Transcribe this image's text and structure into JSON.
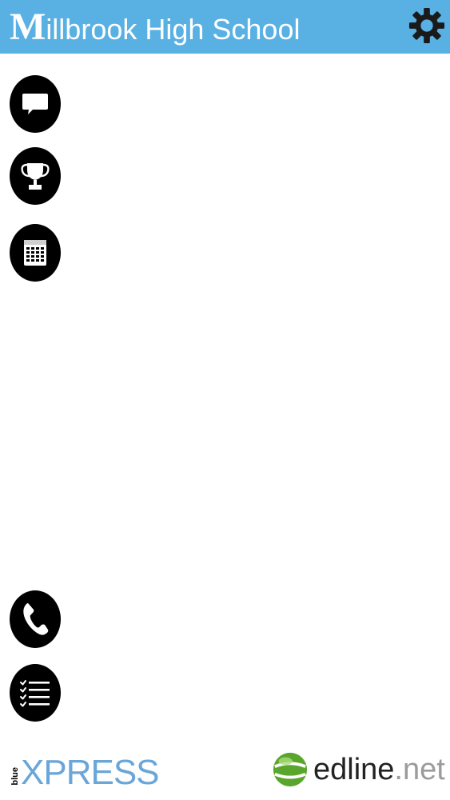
{
  "header": {
    "title_initial": "M",
    "title_rest": "illbrook High School",
    "background_color": "#58b0e3",
    "settings_icon": "gear-icon"
  },
  "nav_top": [
    {
      "icon": "message-icon"
    },
    {
      "icon": "trophy-icon"
    },
    {
      "icon": "calendar-icon"
    }
  ],
  "nav_bottom": [
    {
      "icon": "phone-icon"
    },
    {
      "icon": "checklist-icon"
    }
  ],
  "footer": {
    "left_brand_small": "blue",
    "left_brand": "XPRESS",
    "right_brand_name": "edline",
    "right_brand_tld": ".net"
  }
}
